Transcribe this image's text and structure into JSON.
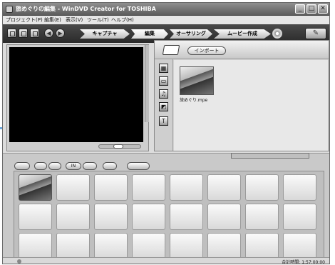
{
  "window": {
    "title": "旅めぐりの編集 - WinDVD Creator for TOSHIBA"
  },
  "menubar": {
    "items": [
      "プロジェクト(P)",
      "編集(E)",
      "表示(V)",
      "ツール(T)",
      "ヘルプ(H)"
    ]
  },
  "toolbar": {
    "steps": [
      {
        "label": "キャプチャ"
      },
      {
        "label": "編集"
      },
      {
        "label": "オーサリング"
      },
      {
        "label": "ムービー作成"
      }
    ]
  },
  "library": {
    "import_label": "インポート",
    "items": [
      {
        "filename": "旅めぐり.mpe"
      }
    ]
  },
  "storyboard": {
    "buttons": [
      "",
      "",
      "",
      "IN",
      "",
      "",
      ""
    ],
    "total_time": "合計時間: 1:57:00:00"
  },
  "colors": {
    "toolbar_bg": "#333333",
    "preview_bg": "#000000",
    "panel_bg": "#d3d3d3"
  }
}
